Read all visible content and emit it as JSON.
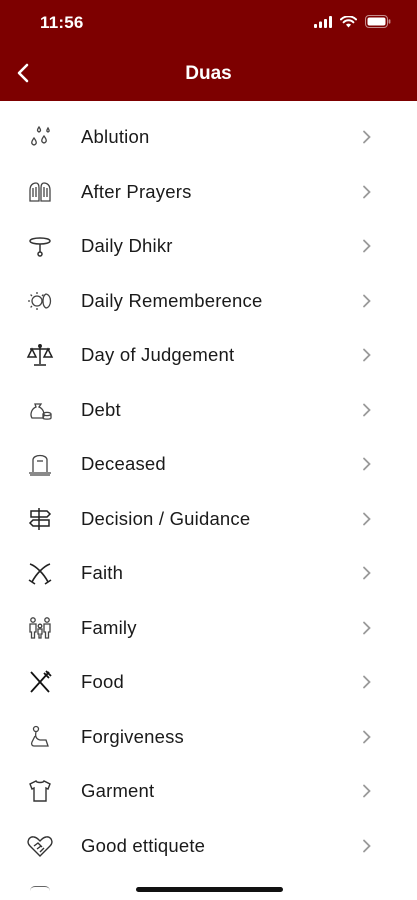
{
  "status_bar": {
    "time": "11:56"
  },
  "header": {
    "title": "Duas"
  },
  "items": [
    {
      "label": "Ablution",
      "icon": "water-drops-icon"
    },
    {
      "label": "After Prayers",
      "icon": "praying-hands-icon"
    },
    {
      "label": "Daily Dhikr",
      "icon": "prayer-beads-icon"
    },
    {
      "label": "Daily Rememberence",
      "icon": "sun-moon-icon"
    },
    {
      "label": "Day of Judgement",
      "icon": "scales-icon"
    },
    {
      "label": "Debt",
      "icon": "money-bag-icon"
    },
    {
      "label": "Deceased",
      "icon": "grave-icon"
    },
    {
      "label": "Decision / Guidance",
      "icon": "signpost-icon"
    },
    {
      "label": "Faith",
      "icon": "crossed-swords-icon"
    },
    {
      "label": "Family",
      "icon": "family-icon"
    },
    {
      "label": "Food",
      "icon": "fork-knife-icon"
    },
    {
      "label": "Forgiveness",
      "icon": "kneeling-person-icon"
    },
    {
      "label": "Garment",
      "icon": "shirt-icon"
    },
    {
      "label": "Good ettiquete",
      "icon": "heart-handshake-icon"
    }
  ],
  "colors": {
    "header_bg": "#7d0000",
    "header_text": "#ffffff",
    "text": "#1a1a1a",
    "chevron": "#9a9a9a"
  }
}
